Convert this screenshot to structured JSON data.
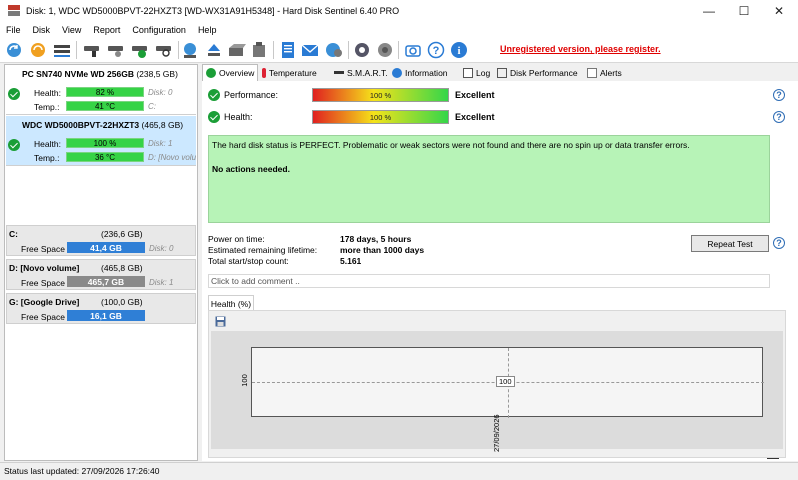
{
  "window": {
    "title": "Disk: 1, WDC WD5000BPVT-22HXZT3 [WD-WX31A91H5348]  -  Hard Disk Sentinel 6.40 PRO",
    "minimize": "—",
    "maximize": "☐",
    "close": "✕"
  },
  "menu": {
    "items": [
      {
        "label": "File"
      },
      {
        "label": "Disk"
      },
      {
        "label": "View"
      },
      {
        "label": "Report"
      },
      {
        "label": "Configuration"
      },
      {
        "label": "Help"
      }
    ]
  },
  "toolbar": {
    "unregistered": "Unregistered version, please register."
  },
  "disks": [
    {
      "name": "PC SN740 NVMe WD 256GB",
      "size": "(238,5 GB)",
      "health_label": "Health:",
      "health_value": "82 %",
      "health_ref": "Disk: 0",
      "temp_label": "Temp.:",
      "temp_value": "41 °C",
      "temp_ref": "C:"
    },
    {
      "name": "WDC WD5000BPVT-22HXZT3",
      "size": "(465,8 GB)",
      "health_label": "Health:",
      "health_value": "100 %",
      "health_ref": "Disk: 1",
      "temp_label": "Temp.:",
      "temp_value": "36 °C",
      "temp_ref": "D: [Novo volu"
    }
  ],
  "partitions": [
    {
      "name": "C:",
      "size": "(236,6 GB)",
      "free_label": "Free Space",
      "free_value": "41,4 GB",
      "disk_ref": "Disk: 0",
      "bar_color": "#2f7fd6"
    },
    {
      "name": "D: [Novo volume]",
      "size": "(465,8 GB)",
      "free_label": "Free Space",
      "free_value": "465,7 GB",
      "disk_ref": "Disk: 1",
      "bar_color": "#8a8a8a"
    },
    {
      "name": "G: [Google Drive]",
      "size": "(100,0 GB)",
      "free_label": "Free Space",
      "free_value": "16,1 GB",
      "disk_ref": "",
      "bar_color": "#2f7fd6"
    }
  ],
  "tabs": [
    {
      "label": "Overview"
    },
    {
      "label": "Temperature"
    },
    {
      "label": "S.M.A.R.T."
    },
    {
      "label": "Information"
    },
    {
      "label": "Log"
    },
    {
      "label": "Disk Performance"
    },
    {
      "label": "Alerts"
    }
  ],
  "overview": {
    "performance_label": "Performance:",
    "performance_value": "100 %",
    "performance_rating": "Excellent",
    "health_label": "Health:",
    "health_value": "100 %",
    "health_rating": "Excellent",
    "status_text": "The hard disk status is PERFECT. Problematic or weak sectors were not found and there are no spin up or data transfer errors.",
    "actions_text": "No actions needed.",
    "power_on_label": "Power on time:",
    "power_on_value": "178 days, 5 hours",
    "lifetime_label": "Estimated remaining lifetime:",
    "lifetime_value": "more than 1000 days",
    "startstop_label": "Total start/stop count:",
    "startstop_value": "5.161",
    "repeat_test": "Repeat Test",
    "comment_placeholder": "Click to add comment ..",
    "chart_tab": "Health (%)"
  },
  "chart_data": {
    "type": "line",
    "x": [
      "27/09/2026"
    ],
    "series": [
      {
        "values": [
          100
        ]
      }
    ],
    "ytick_labels": [
      "100"
    ],
    "xtick_labels": [
      "27/09/2026"
    ],
    "data_labels": [
      "100"
    ]
  },
  "status_bar": {
    "text": "Status last updated: 27/09/2026 17:26:40"
  }
}
